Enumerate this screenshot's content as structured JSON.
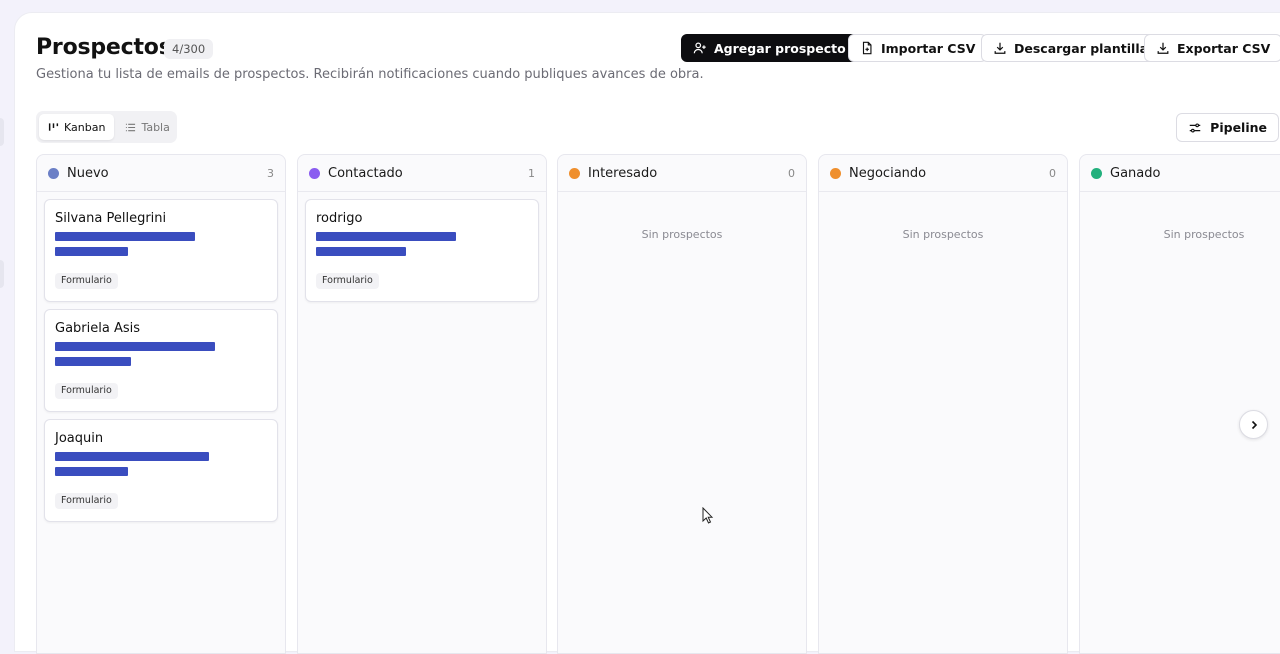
{
  "header": {
    "title": "Prospectos",
    "count": "4/300",
    "subtitle": "Gestiona tu lista de emails de prospectos. Recibirán notificaciones cuando publiques avances de obra."
  },
  "actions": {
    "add": "Agregar prospecto",
    "import": "Importar CSV",
    "template": "Descargar plantilla",
    "export": "Exportar CSV"
  },
  "view": {
    "kanban": "Kanban",
    "table": "Tabla",
    "pipeline": "Pipeline"
  },
  "colors": {
    "nuevo": "#6b7fc6",
    "contactado": "#8a5cf0",
    "interesado": "#ef8f2d",
    "negociando": "#ef8f2d",
    "ganado": "#22b07d",
    "redaction": "#3a4dbf"
  },
  "columns": [
    {
      "name": "Nuevo",
      "count": "3",
      "empty": "",
      "cards": [
        {
          "name": "Silvana Pellegrini",
          "tag": "Formulario"
        },
        {
          "name": "Gabriela Asis",
          "tag": "Formulario"
        },
        {
          "name": "Joaquin",
          "tag": "Formulario"
        }
      ]
    },
    {
      "name": "Contactado",
      "count": "1",
      "empty": "",
      "cards": [
        {
          "name": "rodrigo",
          "tag": "Formulario"
        }
      ]
    },
    {
      "name": "Interesado",
      "count": "0",
      "empty": "Sin prospectos",
      "cards": []
    },
    {
      "name": "Negociando",
      "count": "0",
      "empty": "Sin prospectos",
      "cards": []
    },
    {
      "name": "Ganado",
      "count": "",
      "empty": "Sin prospectos",
      "cards": []
    }
  ]
}
